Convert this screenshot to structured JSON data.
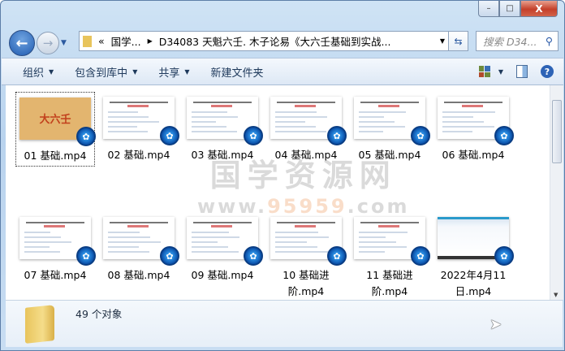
{
  "window": {
    "minimize": "–",
    "maximize": "□",
    "close": "X"
  },
  "nav": {
    "back": "←",
    "forward": "→"
  },
  "address": {
    "prefix": "«",
    "parts": [
      "国学...",
      "D34083 天魁六壬. 木子论易《大六壬基础到实战..."
    ]
  },
  "search": {
    "placeholder": "搜索 D34...",
    "icon": "⚲"
  },
  "toolbar": {
    "organize": "组织",
    "include_library": "包含到库中",
    "share": "共享",
    "new_folder": "新建文件夹",
    "help": "?"
  },
  "watermark": {
    "line1": "国学资源网",
    "line2_pre": "www.",
    "line2_num": "95959",
    ".com_suffix": ".com"
  },
  "files": [
    {
      "name": "01 基础.mp4",
      "thumb": "orange",
      "thumb_text": "大六壬"
    },
    {
      "name": "02 基础.mp4",
      "thumb": "slide"
    },
    {
      "name": "03 基础.mp4",
      "thumb": "slide"
    },
    {
      "name": "04 基础.mp4",
      "thumb": "slide"
    },
    {
      "name": "05 基础.mp4",
      "thumb": "slide"
    },
    {
      "name": "06 基础.mp4",
      "thumb": "slide"
    },
    {
      "name": "07 基础.mp4",
      "thumb": "slide"
    },
    {
      "name": "08 基础.mp4",
      "thumb": "slide"
    },
    {
      "name": "09 基础.mp4",
      "thumb": "slide"
    },
    {
      "name": "10 基础进阶.mp4",
      "thumb": "slide"
    },
    {
      "name": "11 基础进阶.mp4",
      "thumb": "slide"
    },
    {
      "name": "2022年4月11日.mp4",
      "thumb": "screen"
    }
  ],
  "status": {
    "count": "49 个对象"
  }
}
